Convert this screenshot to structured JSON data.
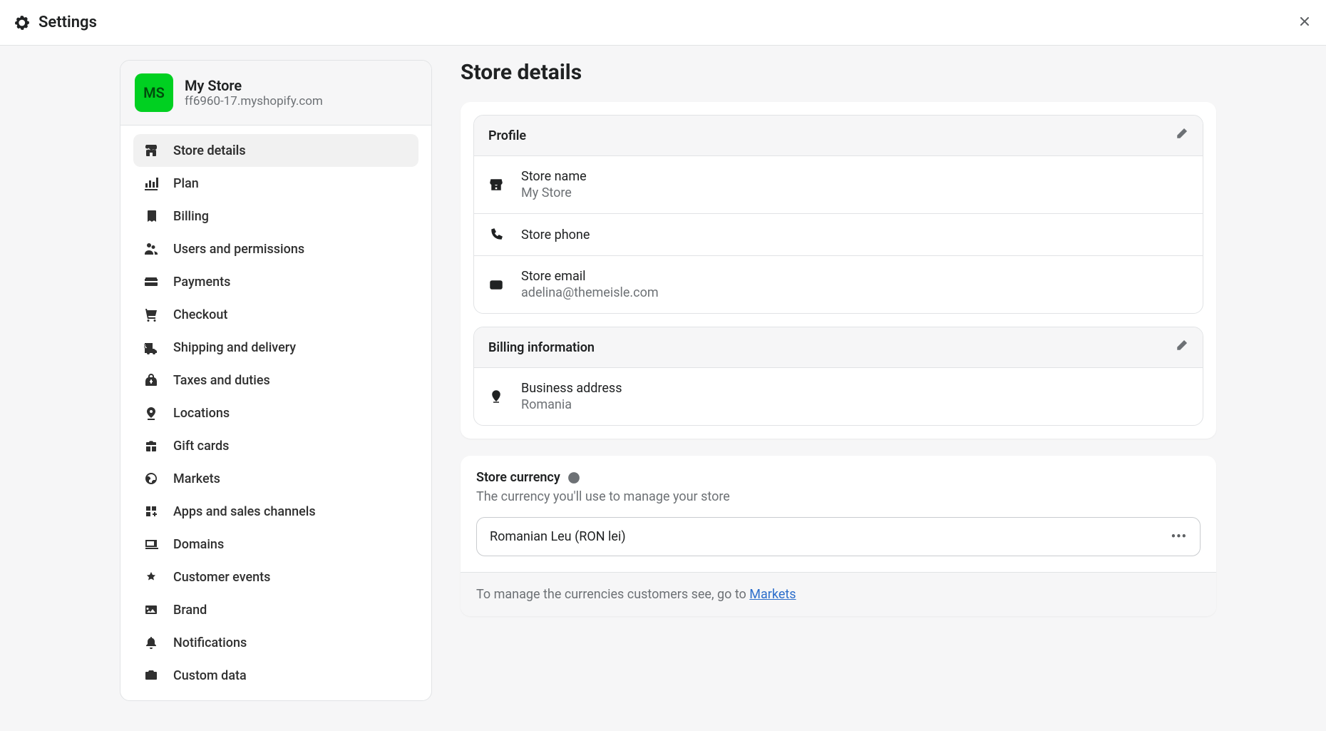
{
  "header": {
    "title": "Settings"
  },
  "store": {
    "avatar_text": "MS",
    "name": "My Store",
    "url": "ff6960-17.myshopify.com"
  },
  "nav": {
    "items": [
      {
        "label": "Store details"
      },
      {
        "label": "Plan"
      },
      {
        "label": "Billing"
      },
      {
        "label": "Users and permissions"
      },
      {
        "label": "Payments"
      },
      {
        "label": "Checkout"
      },
      {
        "label": "Shipping and delivery"
      },
      {
        "label": "Taxes and duties"
      },
      {
        "label": "Locations"
      },
      {
        "label": "Gift cards"
      },
      {
        "label": "Markets"
      },
      {
        "label": "Apps and sales channels"
      },
      {
        "label": "Domains"
      },
      {
        "label": "Customer events"
      },
      {
        "label": "Brand"
      },
      {
        "label": "Notifications"
      },
      {
        "label": "Custom data"
      }
    ]
  },
  "page": {
    "title": "Store details"
  },
  "profile": {
    "title": "Profile",
    "store_name_label": "Store name",
    "store_name_value": "My Store",
    "store_phone_label": "Store phone",
    "store_email_label": "Store email",
    "store_email_value": "adelina@themeisle.com"
  },
  "billing": {
    "title": "Billing information",
    "address_label": "Business address",
    "address_value": "Romania"
  },
  "currency": {
    "title": "Store currency",
    "subtitle": "The currency you'll use to manage your store",
    "selected": "Romanian Leu (RON lei)",
    "footer_text": "To manage the currencies customers see, go to ",
    "footer_link": "Markets"
  }
}
